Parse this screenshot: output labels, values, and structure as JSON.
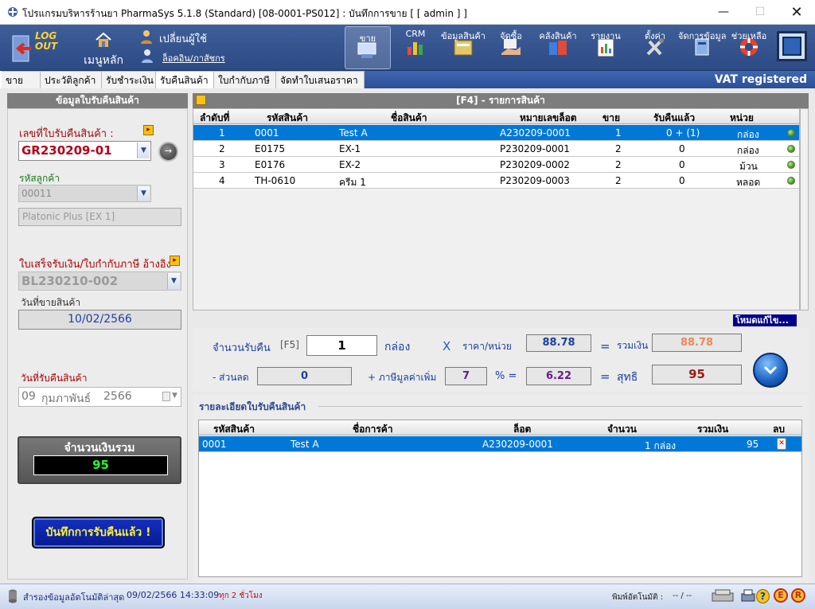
{
  "window": {
    "title": "โปรแกรมบริหารร้านยา PharmaSys 5.1.8 (Standard) [08-0001-PS012] : บันทึกการขาย  [ [ admin ] ]"
  },
  "toolbar": {
    "logout_label": "LOG OUT",
    "home_label": "เมนูหลัก",
    "change_user_label": "เปลี่ยนผู้ใช้",
    "login_history_label": "ล็อคอิน/ภาสัชกร",
    "items": [
      {
        "label": "ขาย"
      },
      {
        "label": "CRM"
      },
      {
        "label": "ข้อมูลสินค้า"
      },
      {
        "label": "จัดซื้อ"
      },
      {
        "label": "คลังสินค้า"
      },
      {
        "label": "รายงาน"
      },
      {
        "label": "ตั้งค่า"
      },
      {
        "label": "จัดการข้อมูล"
      },
      {
        "label": "ช่วยเหลือ"
      }
    ]
  },
  "tabs": [
    {
      "label": "ขาย"
    },
    {
      "label": "ประวัติลูกค้า"
    },
    {
      "label": "รับชำระเงิน"
    },
    {
      "label": "รับคืนสินค้า"
    },
    {
      "label": "ใบกำกับภาษี"
    },
    {
      "label": "จัดทำใบเสนอราคา"
    }
  ],
  "vat_label": "VAT registered",
  "left_panel": {
    "header": "ข้อมูลใบรับคืนสินค้า",
    "receipt_no_label": "เลขที่ใบรับคืนสินค้า :",
    "receipt_no_value": "GR230209-01",
    "customer_code_label": "รหัสลูกค้า",
    "customer_code_value": "00011",
    "customer_name_value": "Platonic Plus [EX 1]",
    "ref_bill_label": "ใบเสร็จรับเงิน/ใบกำกับภาษี อ้างอิง",
    "ref_bill_value": "BL230210-002",
    "sale_date_label": "วันที่ขายสินค้า",
    "sale_date_value": "10/02/2566",
    "return_date_label": "วันที่รับคืนสินค้า",
    "return_date_day": "09",
    "return_date_month": "กุมภาพันธ์",
    "return_date_year": "2566",
    "total_label": "จำนวนเงินรวม",
    "total_value": "95",
    "save_button": "บันทึกการรับคืนแล้ว !"
  },
  "product_list": {
    "header": "[F4] - รายการสินค้า",
    "columns": [
      "ลำดับที่",
      "รหัสสินค้า",
      "ชื่อสินค้า",
      "หมายเลขล็อต",
      "ขาย",
      "รับคืนแล้ว",
      "หน่วย"
    ],
    "rows": [
      {
        "no": "1",
        "code": "0001",
        "name": "Test A",
        "lot": "A230209-0001",
        "sold": "1",
        "returned": "0 + (1)",
        "unit": "กล่อง"
      },
      {
        "no": "2",
        "code": "E0175",
        "name": "EX-1",
        "lot": "P230209-0001",
        "sold": "2",
        "returned": "0",
        "unit": "กล่อง"
      },
      {
        "no": "3",
        "code": "E0176",
        "name": "EX-2",
        "lot": "P230209-0002",
        "sold": "2",
        "returned": "0",
        "unit": "ม้วน"
      },
      {
        "no": "4",
        "code": "TH-0610",
        "name": "ครีม 1",
        "lot": "P230209-0003",
        "sold": "2",
        "returned": "0",
        "unit": "หลอด"
      }
    ],
    "edit_mode_label": "โหมดแก้ไข..."
  },
  "calc": {
    "qty_label": "จำนวนรับคืน",
    "qty_key": "[F5]",
    "qty_value": "1",
    "qty_unit": "กล่อง",
    "times": "X",
    "price_label": "ราคา/หน่วย",
    "price_value": "88.78",
    "eq1": "=",
    "sum_label": "รวมเงิน",
    "sum_value": "88.78",
    "discount_label": "- ส่วนลด",
    "discount_value": "0",
    "vat_label": "+ ภาษีมูลค่าเพิ่ม",
    "vat_rate": "7",
    "vat_pct": "% =",
    "vat_value": "6.22",
    "eq2": "=",
    "net_label": "สุทธิ",
    "net_value": "95"
  },
  "detail": {
    "title": "รายละเอียดใบรับคืนสินค้า",
    "columns": [
      "รหัสสินค้า",
      "ชื่อการค้า",
      "ล็อต",
      "จำนวน",
      "รวมเงิน",
      "ลบ"
    ],
    "rows": [
      {
        "code": "0001",
        "name": "Test A",
        "lot": "A230209-0001",
        "qty": "1 กล่อง",
        "total": "95"
      }
    ]
  },
  "status": {
    "backup_label": "สำรองข้อมูลอัตโนมัติล่าสุด",
    "backup_time": "09/02/2566 14:33:09",
    "backup_interval": "ทุก 2 ชั่วโมง",
    "auto_print_label": "พิมพ์อัตโนมัติ :",
    "auto_print_value": "--  /  --"
  },
  "colors": {
    "toolbar_bg": "#2f4d88",
    "selection": "#0078d7",
    "receipt_no_red": "#b3001b",
    "total_green": "#22ff22"
  }
}
